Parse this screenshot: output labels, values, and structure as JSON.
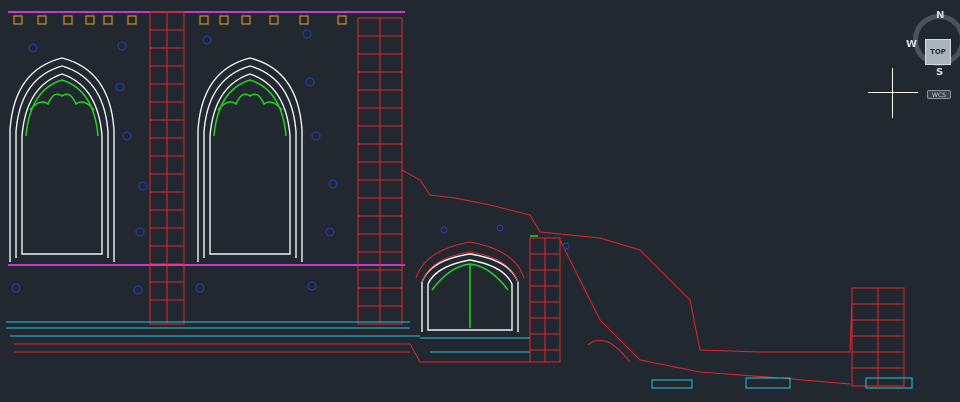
{
  "viewcube": {
    "north_label": "N",
    "south_label": "S",
    "west_label": "W",
    "face_label": "TOP"
  },
  "ucs": {
    "label": "WCS"
  },
  "colors": {
    "background": "#212830",
    "masonry": "#e3262c",
    "outline": "#f2f4f5",
    "ornament": "#27d321",
    "base": "#22c7d8",
    "parapet": "#ff40ff",
    "crenel": "#f2a32a",
    "grid_label": "#2b3bb8"
  },
  "icons": {
    "cursor": "crosshair-icon",
    "navigation": "viewcube-icon"
  }
}
